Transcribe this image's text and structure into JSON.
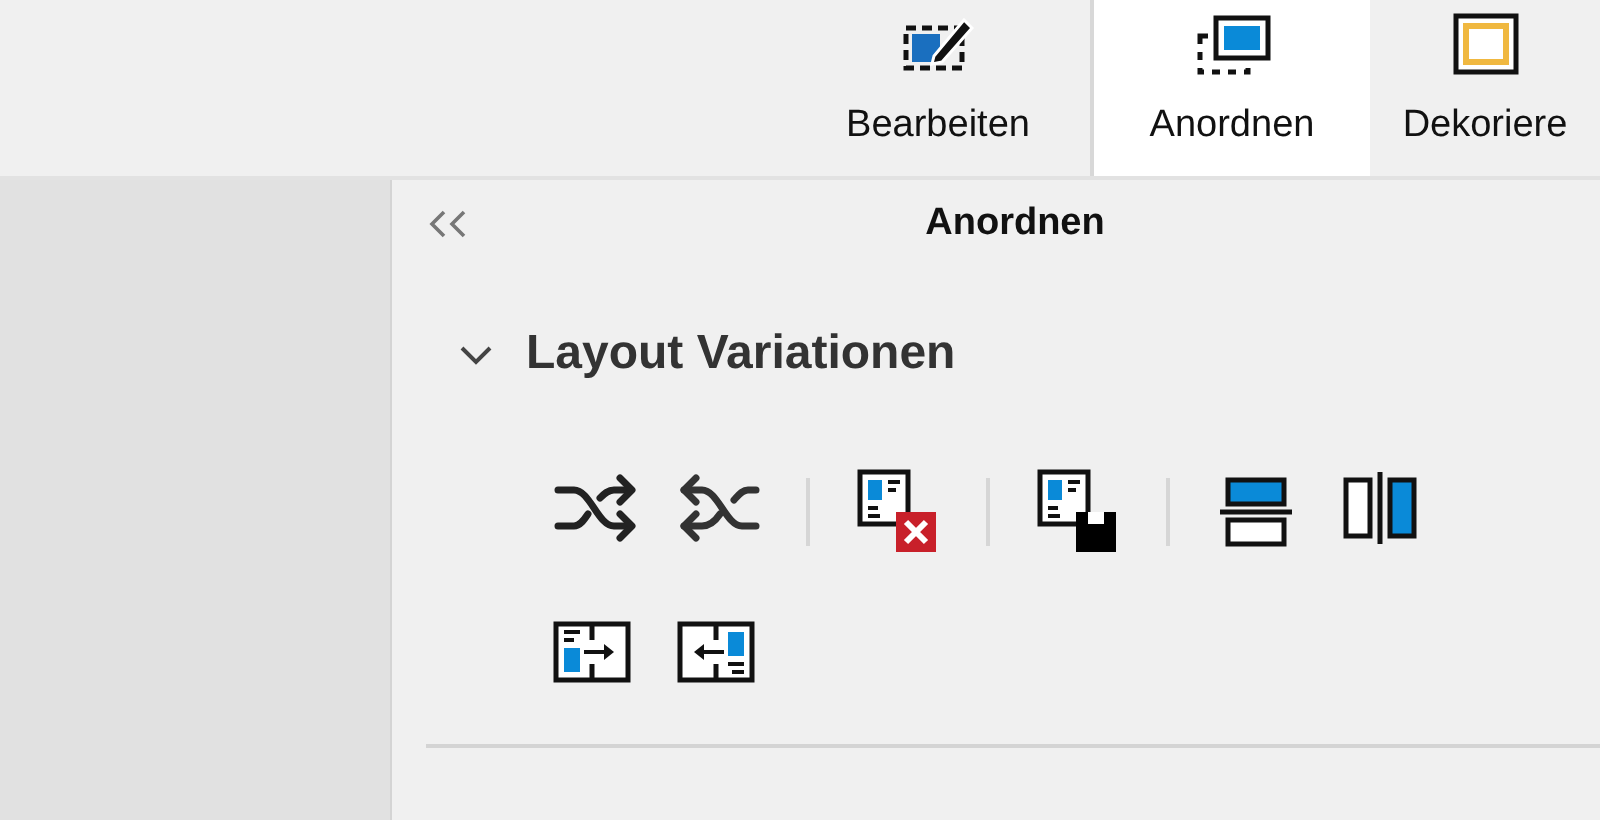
{
  "tabs": [
    {
      "label": "Bearbeiten",
      "selected": false,
      "kind": "edit"
    },
    {
      "label": "Anordnen",
      "selected": true,
      "kind": "arrange"
    },
    {
      "label": "Dekoriere",
      "selected": false,
      "kind": "decorate"
    }
  ],
  "panel": {
    "title": "Anordnen",
    "section": {
      "title": "Layout Variationen",
      "expanded": true
    }
  }
}
